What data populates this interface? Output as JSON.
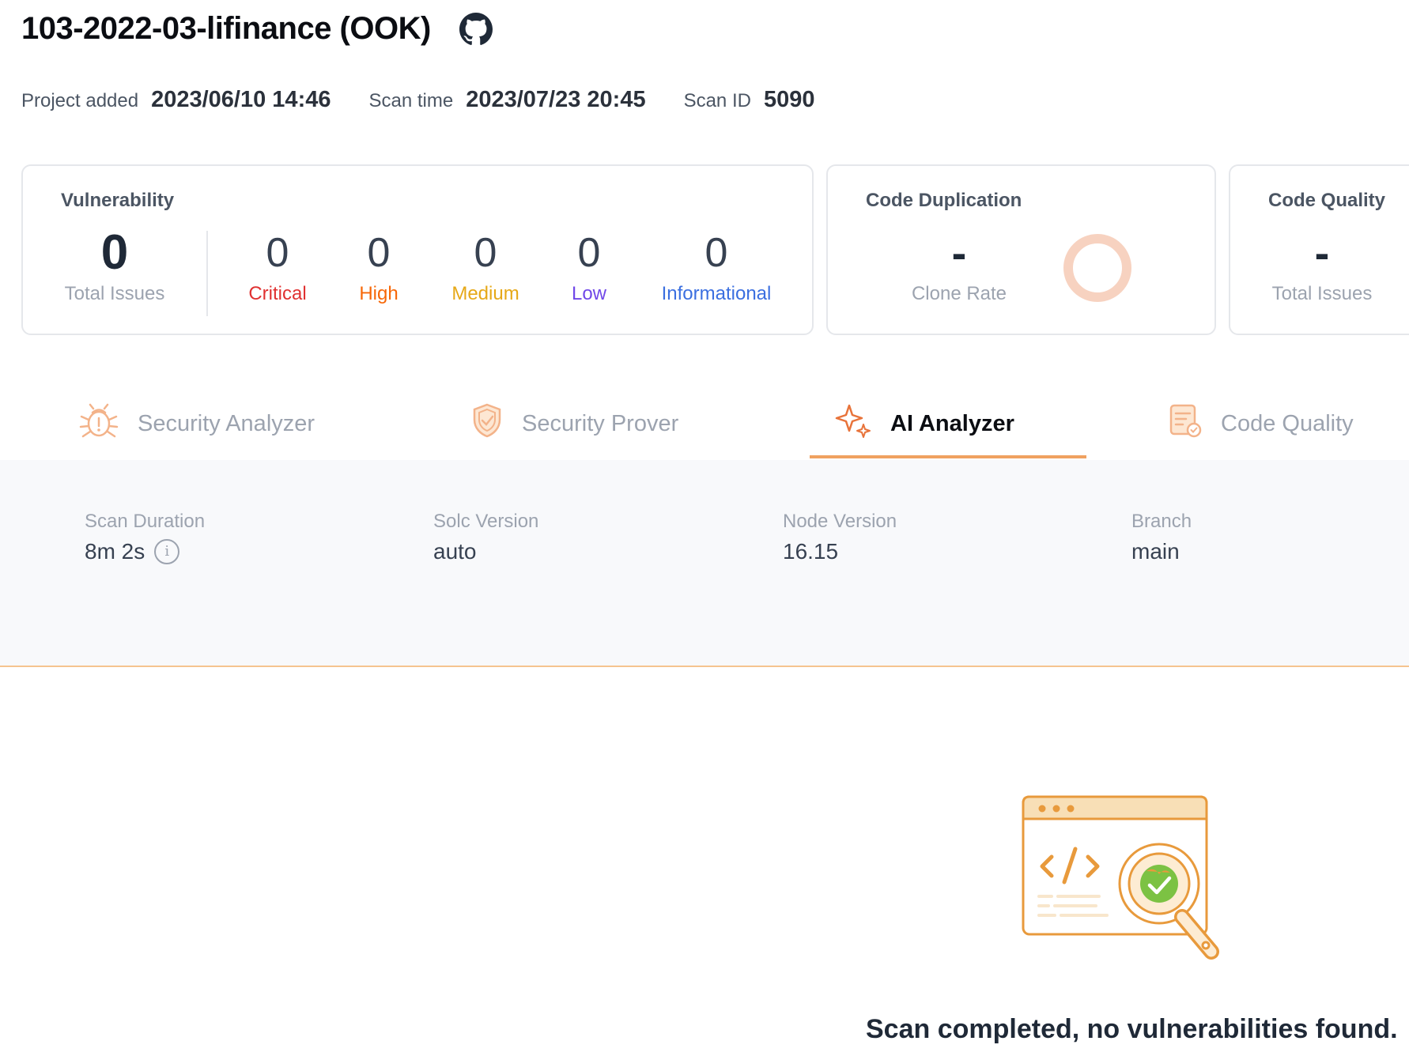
{
  "project": {
    "title": "103-2022-03-lifinance (OOK)",
    "github_icon": "github-icon"
  },
  "meta": {
    "project_added_label": "Project added",
    "project_added_value": "2023/06/10 14:46",
    "scan_time_label": "Scan time",
    "scan_time_value": "2023/07/23 20:45",
    "scan_id_label": "Scan ID",
    "scan_id_value": "5090"
  },
  "vulnerability": {
    "title": "Vulnerability",
    "total": {
      "value": "0",
      "label": "Total Issues"
    },
    "critical": {
      "value": "0",
      "label": "Critical",
      "color": "#e03131"
    },
    "high": {
      "value": "0",
      "label": "High",
      "color": "#f76707"
    },
    "medium": {
      "value": "0",
      "label": "Medium",
      "color": "#e6a817"
    },
    "low": {
      "value": "0",
      "label": "Low",
      "color": "#7048e8"
    },
    "informational": {
      "value": "0",
      "label": "Informational",
      "color": "#3b6fe0"
    }
  },
  "code_duplication": {
    "title": "Code Duplication",
    "value": "-",
    "label": "Clone Rate"
  },
  "code_quality": {
    "title": "Code Quality",
    "value": "-",
    "label": "Total Issues"
  },
  "tabs": [
    {
      "label": "Security Analyzer",
      "icon": "bug-icon",
      "active": false
    },
    {
      "label": "Security Prover",
      "icon": "shield-icon",
      "active": false
    },
    {
      "label": "AI Analyzer",
      "icon": "sparkle-icon",
      "active": true
    },
    {
      "label": "Code Quality",
      "icon": "document-check-icon",
      "active": false
    }
  ],
  "scan_info": {
    "duration_label": "Scan Duration",
    "duration_value": "8m 2s",
    "solc_label": "Solc Version",
    "solc_value": "auto",
    "node_label": "Node Version",
    "node_value": "16.15",
    "branch_label": "Branch",
    "branch_value": "main"
  },
  "result": {
    "message": "Scan completed, no vulnerabilities found.",
    "illustration": "code-scan-magnifier-illustration"
  },
  "colors": {
    "accent": "#f0a160",
    "accent_light": "#f5c48f"
  }
}
